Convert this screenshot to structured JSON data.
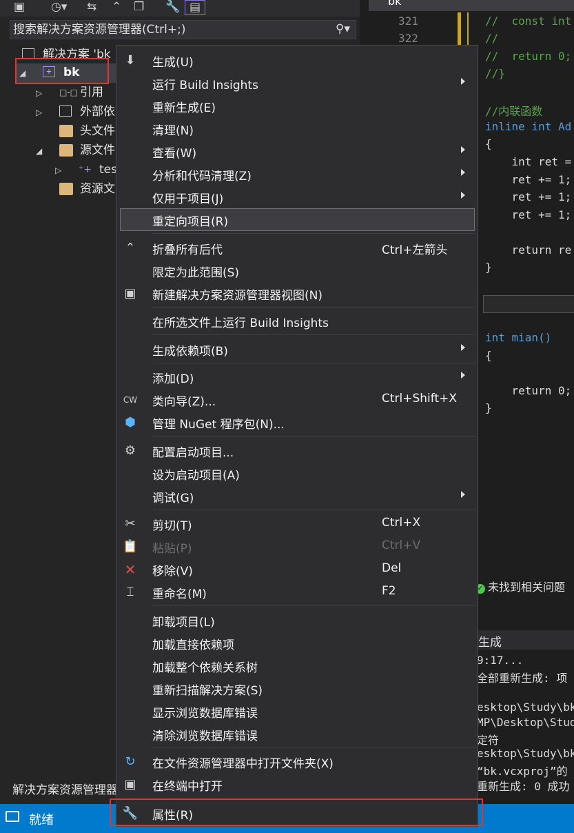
{
  "solution_explorer": {
    "search_placeholder": "搜索解决方案资源管理器(Ctrl+;)",
    "tree": {
      "solution": "解决方案 'bk",
      "project": "bk",
      "references": "引用",
      "external_deps": "外部依",
      "header_files": "头文件",
      "source_files": "源文件",
      "test_file": "tes",
      "resource_files": "资源文"
    },
    "footer": "解决方案资源管理器"
  },
  "editor": {
    "tab": "bk",
    "line_numbers": [
      "321",
      "322"
    ],
    "lines": [
      "//  const int",
      "//",
      "//  return 0;",
      "//}",
      "//内联函数",
      "inline int Ad",
      "{",
      "    int ret =",
      "    ret += 1;",
      "    ret += 1;",
      "    ret += 1;",
      "    return re",
      "}",
      "int mian()",
      "{",
      "    return 0;",
      "}"
    ]
  },
  "issues": {
    "text": "未找到相关问题"
  },
  "output": {
    "title": "生成",
    "lines": [
      "9:17...",
      "全部重新生成: 项",
      "esktop\\Study\\bk\\",
      "MP\\Desktop\\Study\\",
      "定符",
      "esktop\\Study\\bk\\",
      "“bk.vcxproj”的",
      "重新生成: 0 成功"
    ]
  },
  "status_bar": {
    "text": "就绪"
  },
  "context_menu": {
    "items": [
      {
        "label": "生成(U)",
        "icon": "build-icon"
      },
      {
        "label": "运行 Build Insights",
        "submenu": true
      },
      {
        "label": "重新生成(E)"
      },
      {
        "label": "清理(N)"
      },
      {
        "label": "查看(W)",
        "submenu": true
      },
      {
        "label": "分析和代码清理(Z)",
        "submenu": true
      },
      {
        "label": "仅用于项目(J)",
        "submenu": true
      },
      {
        "label": "重定向项目(R)",
        "hover": true
      },
      {
        "label": "折叠所有后代",
        "shortcut": "Ctrl+左箭头",
        "icon": "collapse-icon"
      },
      {
        "label": "限定为此范围(S)"
      },
      {
        "label": "新建解决方案资源管理器视图(N)",
        "icon": "new-view-icon"
      },
      {
        "label": "在所选文件上运行 Build Insights"
      },
      {
        "label": "生成依赖项(B)",
        "submenu": true
      },
      {
        "label": "添加(D)",
        "submenu": true
      },
      {
        "label": "类向导(Z)...",
        "shortcut": "Ctrl+Shift+X",
        "icon": "class-wizard-icon"
      },
      {
        "label": "管理 NuGet 程序包(N)...",
        "icon": "nuget-icon"
      },
      {
        "label": "配置启动项目...",
        "icon": "gear-icon"
      },
      {
        "label": "设为启动项目(A)"
      },
      {
        "label": "调试(G)",
        "submenu": true
      },
      {
        "label": "剪切(T)",
        "shortcut": "Ctrl+X",
        "icon": "scissors-icon"
      },
      {
        "label": "粘贴(P)",
        "shortcut": "Ctrl+V",
        "icon": "paste-icon",
        "disabled": true
      },
      {
        "label": "移除(V)",
        "shortcut": "Del",
        "icon": "remove-icon"
      },
      {
        "label": "重命名(M)",
        "shortcut": "F2",
        "icon": "rename-icon"
      },
      {
        "label": "卸载项目(L)"
      },
      {
        "label": "加载直接依赖项"
      },
      {
        "label": "加载整个依赖关系树"
      },
      {
        "label": "重新扫描解决方案(S)"
      },
      {
        "label": "显示浏览数据库错误"
      },
      {
        "label": "清除浏览数据库错误"
      },
      {
        "label": "在文件资源管理器中打开文件夹(X)",
        "icon": "open-folder-icon"
      },
      {
        "label": "在终端中打开",
        "icon": "terminal-icon"
      },
      {
        "label": "属性(R)",
        "icon": "wrench-icon"
      }
    ]
  },
  "colors": {
    "accent": "#007acc",
    "highlight": "#e03535",
    "menu_bg": "#2d2d30"
  }
}
